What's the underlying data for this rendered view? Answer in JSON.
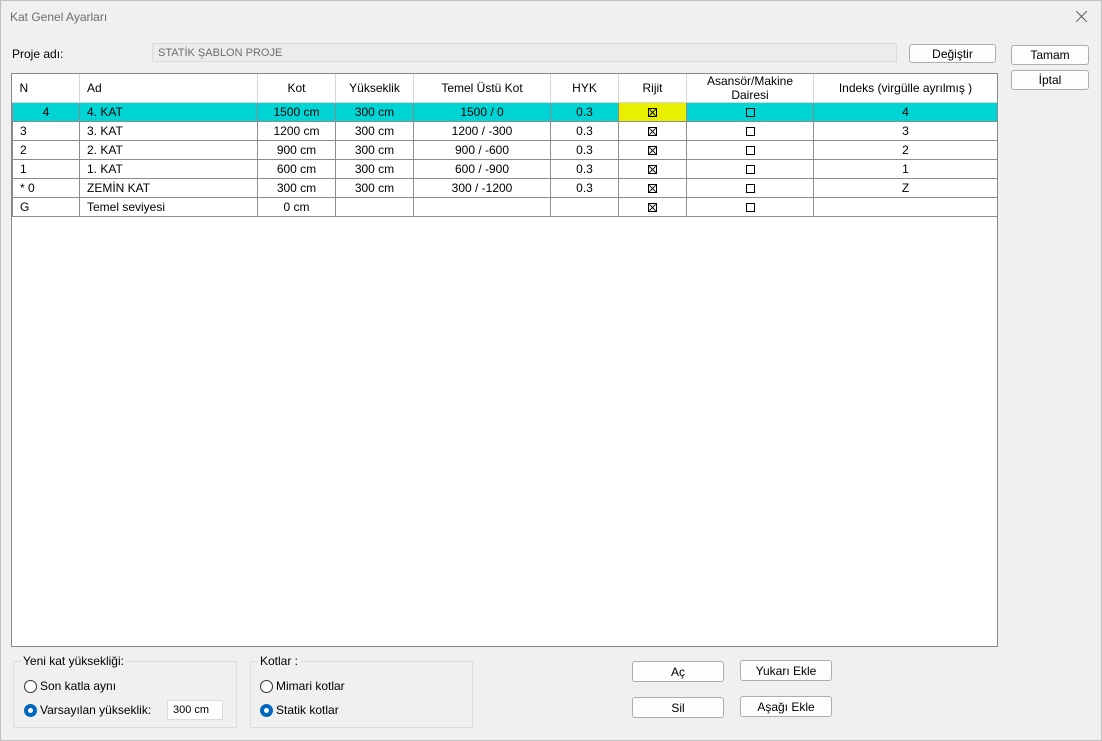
{
  "window": {
    "title": "Kat Genel Ayarları"
  },
  "project": {
    "label": "Proje adı:",
    "value": "STATİK ŞABLON PROJE",
    "change_button": "Değiştir"
  },
  "dialog_buttons": {
    "ok": "Tamam",
    "cancel": "İptal"
  },
  "table": {
    "columns": [
      "N",
      "Ad",
      "Kot",
      "Yükseklik",
      "Temel Üstü Kot",
      "HYK",
      "Rijit",
      "Asansör/Makine Dairesi",
      "Indeks (virgülle ayrılmış )"
    ],
    "rows": [
      {
        "n": "4",
        "ad": "4. KAT",
        "kot": "1500 cm",
        "yukseklik": "300 cm",
        "temel": "1500 / 0",
        "hyk": "0.3",
        "rijit": true,
        "asansor": false,
        "indeks": "4",
        "selected": true
      },
      {
        "n": "3",
        "ad": "3. KAT",
        "kot": "1200 cm",
        "yukseklik": "300 cm",
        "temel": "1200 / -300",
        "hyk": "0.3",
        "rijit": true,
        "asansor": false,
        "indeks": "3"
      },
      {
        "n": "2",
        "ad": "2. KAT",
        "kot": "900 cm",
        "yukseklik": "300 cm",
        "temel": "900 / -600",
        "hyk": "0.3",
        "rijit": true,
        "asansor": false,
        "indeks": "2"
      },
      {
        "n": "1",
        "ad": "1. KAT",
        "kot": "600 cm",
        "yukseklik": "300 cm",
        "temel": "600 / -900",
        "hyk": "0.3",
        "rijit": true,
        "asansor": false,
        "indeks": "1"
      },
      {
        "n": "* 0",
        "ad": "ZEMİN KAT",
        "kot": "300 cm",
        "yukseklik": "300 cm",
        "temel": "300 / -1200",
        "hyk": "0.3",
        "rijit": true,
        "asansor": false,
        "indeks": "Z"
      },
      {
        "n": "G",
        "ad": "Temel seviyesi",
        "kot": "0 cm",
        "yukseklik": "",
        "temel": "",
        "hyk": "",
        "rijit": true,
        "asansor": false,
        "indeks": ""
      }
    ]
  },
  "new_floor_height": {
    "label": "Yeni kat yüksekliği:",
    "option_same": "Son katla aynı",
    "option_default": "Varsayılan yükseklik:",
    "default_value": "300 cm",
    "selected": "default"
  },
  "levels": {
    "label": "Kotlar :",
    "option_arch": "Mimari kotlar",
    "option_static": "Statik kotlar",
    "selected": "static"
  },
  "actions": {
    "open": "Aç",
    "delete": "Sil",
    "add_above": "Yukarı Ekle",
    "add_below": "Aşağı Ekle"
  },
  "colors": {
    "selected_row": "#00d4d4",
    "selected_cell": "#e8f000",
    "radio_accent": "#0067c0"
  }
}
